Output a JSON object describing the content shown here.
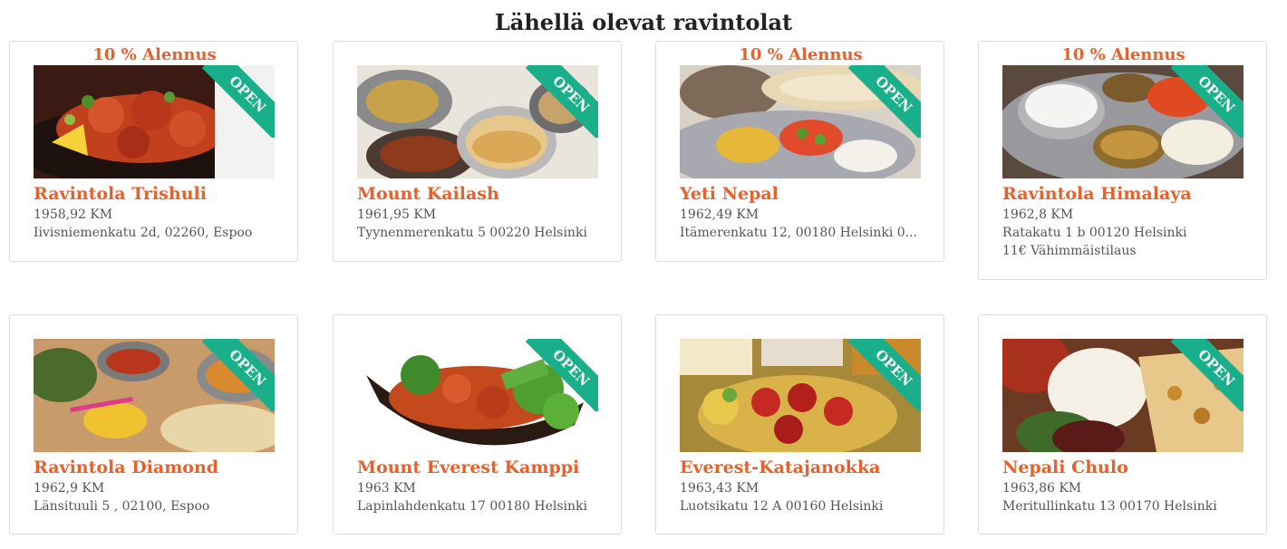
{
  "page": {
    "title": "Lähellä olevat ravintolat"
  },
  "colors": {
    "accent": "#e8612c",
    "ribbon": "#1aaf8b",
    "text_muted": "#555555",
    "border": "#dcdcdc"
  },
  "restaurants": [
    {
      "discount": "10 % Alennus",
      "open_label": "OPEN",
      "name": "Ravintola Trishuli",
      "distance": "1958,92 KM",
      "address": "Iivisniemenkatu 2d, 02260, Espoo",
      "min_order": ""
    },
    {
      "discount": "",
      "open_label": "OPEN",
      "name": "Mount Kailash",
      "distance": "1961,95 KM",
      "address": "Tyynenmerenkatu 5 00220 Helsinki",
      "min_order": ""
    },
    {
      "discount": "10 % Alennus",
      "open_label": "OPEN",
      "name": "Yeti Nepal",
      "distance": "1962,49 KM",
      "address": "Itämerenkatu 12, 00180 Helsinki 0...",
      "min_order": ""
    },
    {
      "discount": "10 % Alennus",
      "open_label": "OPEN",
      "name": "Ravintola Himalaya",
      "distance": "1962,8 KM",
      "address": "Ratakatu 1 b 00120 Helsinki",
      "min_order": "11€ Vähimmäistilaus"
    },
    {
      "discount": "",
      "open_label": "OPEN",
      "name": "Ravintola Diamond",
      "distance": "1962,9 KM",
      "address": "Länsituuli 5 , 02100, Espoo",
      "min_order": ""
    },
    {
      "discount": "",
      "open_label": "OPEN",
      "name": "Mount Everest Kamppi",
      "distance": "1963 KM",
      "address": "Lapinlahdenkatu 17 00180 Helsinki",
      "min_order": ""
    },
    {
      "discount": "",
      "open_label": "OPEN",
      "name": "Everest-Katajanokka",
      "distance": "1963,43 KM",
      "address": "Luotsikatu 12 A 00160 Helsinki",
      "min_order": ""
    },
    {
      "discount": "",
      "open_label": "OPEN",
      "name": "Nepali Chulo",
      "distance": "1963,86 KM",
      "address": "Meritullinkatu 13 00170 Helsinki",
      "min_order": ""
    }
  ]
}
